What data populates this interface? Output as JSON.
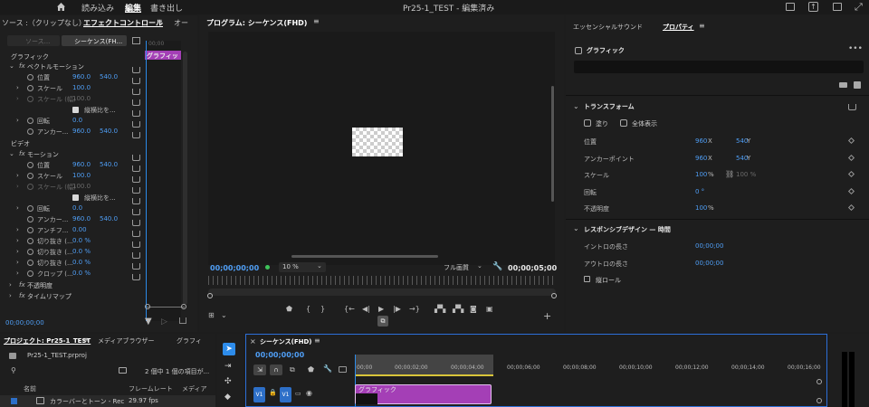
{
  "window": {
    "title": "Pr25-1_TEST - 編集済み",
    "menu": [
      "読み込み",
      "編集",
      "書き出し"
    ],
    "active_menu": "編集"
  },
  "effect_controls": {
    "tabs": [
      "ソース :（クリップなし）",
      "エフェクトコントロール",
      "オー"
    ],
    "source_btn": "ソース...",
    "sequence_btn": "シーケンス(FH...",
    "timecode_small": "00;00",
    "clip_label": "グラフィッ",
    "section_graphic": "グラフィック",
    "vector_motion": "ベクトルモーション",
    "position_label": "位置",
    "position_x": "960.0",
    "position_y": "540.0",
    "scale_label": "スケール",
    "scale_value": "100.0",
    "scale_w_label": "スケール (幅)",
    "scale_w_value": "100.0",
    "uniform_label": "縦横比を...",
    "rotation_label": "回転",
    "rotation_value": "0.0",
    "anchor_label": "アンカー...",
    "anchor_x": "960.0",
    "anchor_y": "540.0",
    "section_video": "ビデオ",
    "motion": "モーション",
    "m_position_x": "960.0",
    "m_position_y": "540.0",
    "m_scale_value": "100.0",
    "m_scale_w_label": "スケール (幅)",
    "m_scale_w_value": "100.0",
    "m_uniform_label": "縦横比を...",
    "m_rotation_value": "0.0",
    "m_anchor_label": "アンカー...",
    "m_anchor_x": "960.0",
    "m_anchor_y": "540.0",
    "antiflicker_label": "アンチフ...",
    "antiflicker_value": "0.00",
    "crop1_label": "切り抜き (...",
    "crop1_value": "0.0 %",
    "crop2_label": "切り抜き (...",
    "crop2_value": "0.0 %",
    "crop3_label": "切り抜き (...",
    "crop3_value": "0.0 %",
    "crop4_label": "クロップ (...",
    "crop4_value": "0.0 %",
    "opacity": "不透明度",
    "time_remap": "タイムリマップ",
    "timecode": "00;00;00;00"
  },
  "program": {
    "tab": "プログラム: シーケンス(FHD)",
    "timecode": "00;00;00;00",
    "zoom": "10 %",
    "quality": "フル画質",
    "duration": "00;00;05;00"
  },
  "properties": {
    "tabs": [
      "エッセンシャルサウンド",
      "プロパティ"
    ],
    "graphic_label": "グラフィック",
    "transform": "トランスフォーム",
    "fill": "塗り",
    "show_all": "全体表示",
    "position_label": "位置",
    "position_x": "960",
    "position_x_unit": "X",
    "position_y": "540",
    "position_y_unit": "Y",
    "anchor_label": "アンカーポイント",
    "anchor_x": "960",
    "anchor_x_unit": "X",
    "anchor_y": "540",
    "anchor_y_unit": "Y",
    "scale_label": "スケール",
    "scale_value": "100",
    "scale_unit": "%",
    "scale2_value": "100 %",
    "rotation_label": "回転",
    "rotation_value": "0 °",
    "opacity_label": "不透明度",
    "opacity_value": "100",
    "opacity_unit": "%",
    "responsive": "レスポンシブデザイン — 時間",
    "intro_label": "イントロの長さ",
    "intro_value": "00;00;00",
    "outro_label": "アウトロの長さ",
    "outro_value": "00;00;00",
    "roll_label": "縦ロール"
  },
  "project": {
    "tabs": [
      "プロジェクト: Pr25-1_TEST",
      "メディアブラウザー",
      "グラフィ"
    ],
    "file": "Pr25-1_TEST.prproj",
    "count": "2 個中 1 個の項目が...",
    "col_name": "名前",
    "col_framerate": "フレームレート",
    "col_media": "メディア",
    "item_name": "カラーバーとトーン - Rec",
    "item_fps": "29.97 fps"
  },
  "timeline": {
    "tab": "シーケンス(FHD)",
    "timecode": "00;00;00;00",
    "ruler": [
      "00;00",
      "00;00;02;00",
      "00;00;04;00",
      "00;00;06;00",
      "00;00;08;00",
      "00;00;10;00",
      "00;00;12;00",
      "00;00;14;00",
      "00;00;16;00"
    ],
    "track_src": "V1",
    "track": "V1",
    "clip": "グラフィック"
  },
  "colors": {
    "accent_blue": "#2d8ceb",
    "clip_purple": "#a43fb6",
    "timecode_blue": "#4f9ef5"
  }
}
